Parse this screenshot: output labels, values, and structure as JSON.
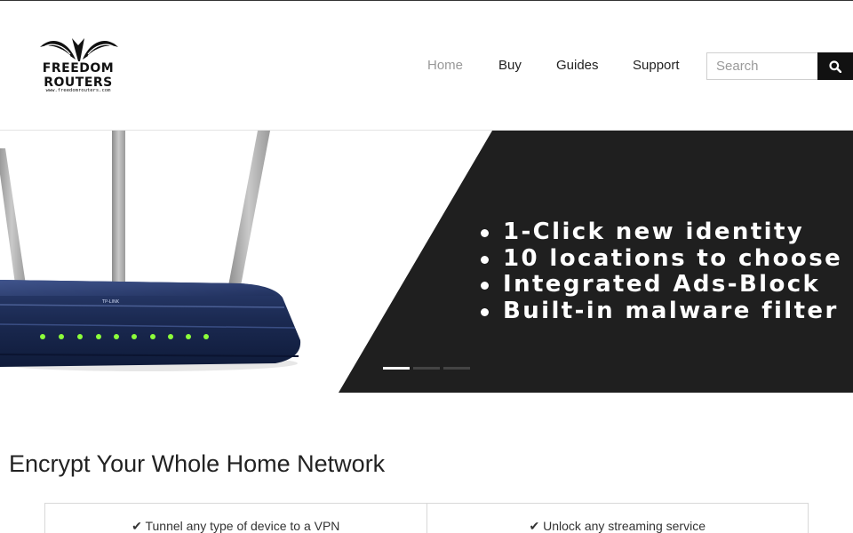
{
  "brand": {
    "name_line1": "FREEDOM",
    "name_line2": "ROUTERS",
    "url": "www.freedomrouters.com"
  },
  "nav": {
    "items": [
      {
        "label": "Home",
        "active": true
      },
      {
        "label": "Buy",
        "active": false
      },
      {
        "label": "Guides",
        "active": false
      },
      {
        "label": "Support",
        "active": false
      }
    ]
  },
  "search": {
    "placeholder": "Search",
    "value": "",
    "icon": "search-icon"
  },
  "hero": {
    "product_label": "TP-LINK",
    "bullets": [
      "1-Click new identity",
      "10 locations to choose",
      "Integrated Ads-Block",
      "Built-in malware filter"
    ],
    "slide_count": 3,
    "active_slide": 1
  },
  "content": {
    "title": "Encrypt Your Whole Home Network",
    "features": [
      "✔ Tunnel any type of device to a VPN",
      "✔ Unlock any streaming service"
    ]
  },
  "colors": {
    "accent_dark": "#1f1f1f",
    "nav_active": "#999999",
    "router_body": "#1b2a52",
    "router_led": "#8cff3a"
  }
}
